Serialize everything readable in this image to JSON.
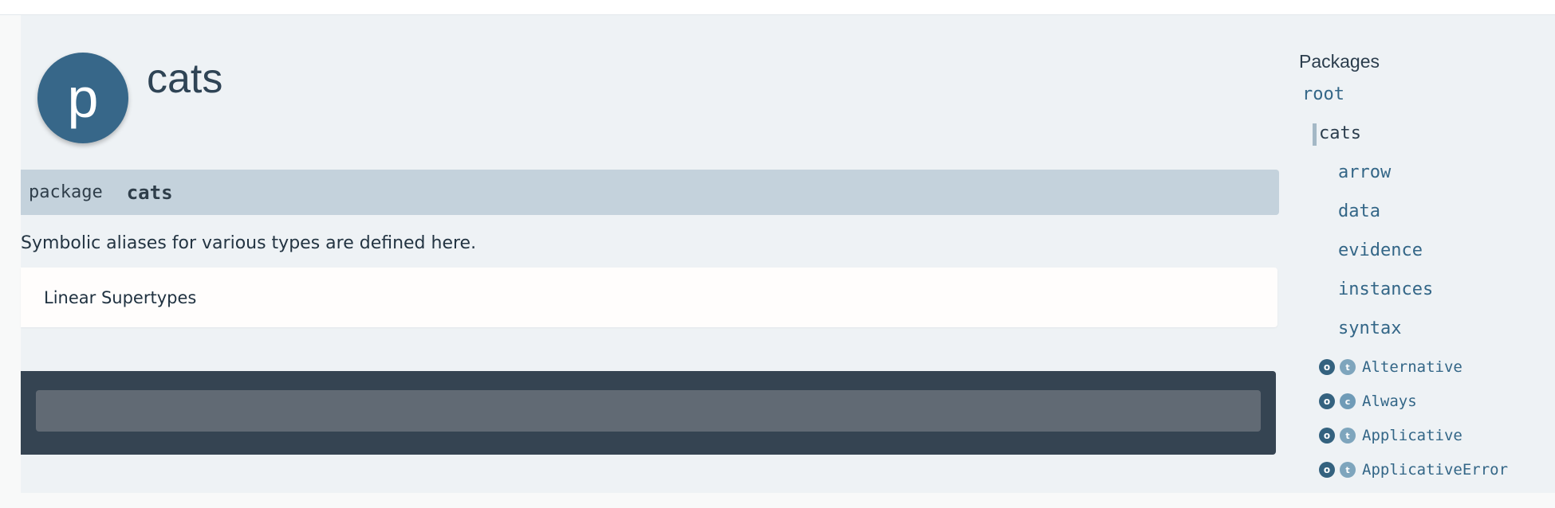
{
  "header": {
    "icon_letter": "p",
    "title": "cats"
  },
  "signature": {
    "keyword": "package",
    "name": "cats"
  },
  "comment": "Symbolic aliases for various types are defined here.",
  "supertypes_label": "Linear Supertypes",
  "sidebar": {
    "heading": "Packages",
    "root": "root",
    "current": "cats",
    "subpackages": [
      "arrow",
      "data",
      "evidence",
      "instances",
      "syntax"
    ],
    "entities": [
      {
        "name": "Alternative",
        "kinds": [
          "o",
          "t"
        ]
      },
      {
        "name": "Always",
        "kinds": [
          "o",
          "c"
        ]
      },
      {
        "name": "Applicative",
        "kinds": [
          "o",
          "t"
        ]
      },
      {
        "name": "ApplicativeError",
        "kinds": [
          "o",
          "t"
        ]
      }
    ]
  },
  "colors": {
    "accent": "#376789",
    "link": "#336687",
    "signature_bg": "#c4d2dc",
    "dark_panel": "#354452"
  }
}
